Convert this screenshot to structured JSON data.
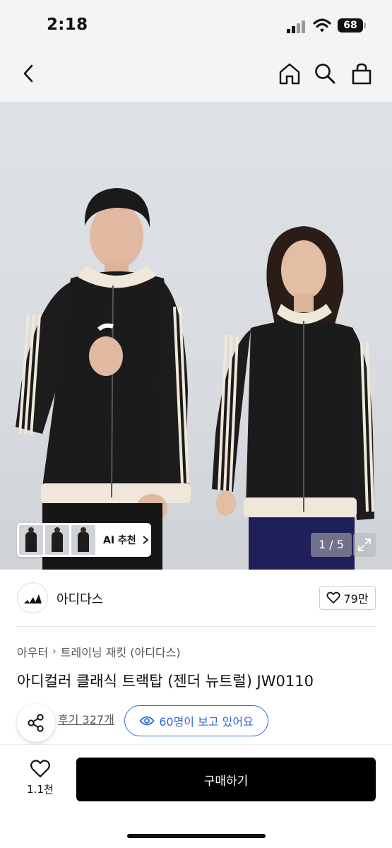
{
  "status": {
    "time": "2:18",
    "battery": "68"
  },
  "nav": {
    "back_icon": "chevron-left-icon",
    "home_icon": "home-icon",
    "search_icon": "search-icon",
    "bag_icon": "shopping-bag-icon"
  },
  "gallery": {
    "ai_recommend_label": "AI 추천",
    "counter": "1 / 5",
    "logo_text": "adidas"
  },
  "brand": {
    "name": "아디다스",
    "likes": "79만"
  },
  "breadcrumb": {
    "level1": "아우터",
    "level2": "트레이닝 재킷 (아디다스)"
  },
  "product": {
    "title": "아디컬러 클래식 트랙탑 (젠더 뉴트럴) JW0110"
  },
  "reviews": {
    "link_label": "후기 327개",
    "viewers_label": "60명이 보고 있어요"
  },
  "bottom": {
    "wish_count": "1.1천",
    "buy_label": "구매하기"
  },
  "colors": {
    "accent_blue": "#2f6bd8",
    "buy_button": "#000000",
    "rating_star": "#f5a623"
  }
}
